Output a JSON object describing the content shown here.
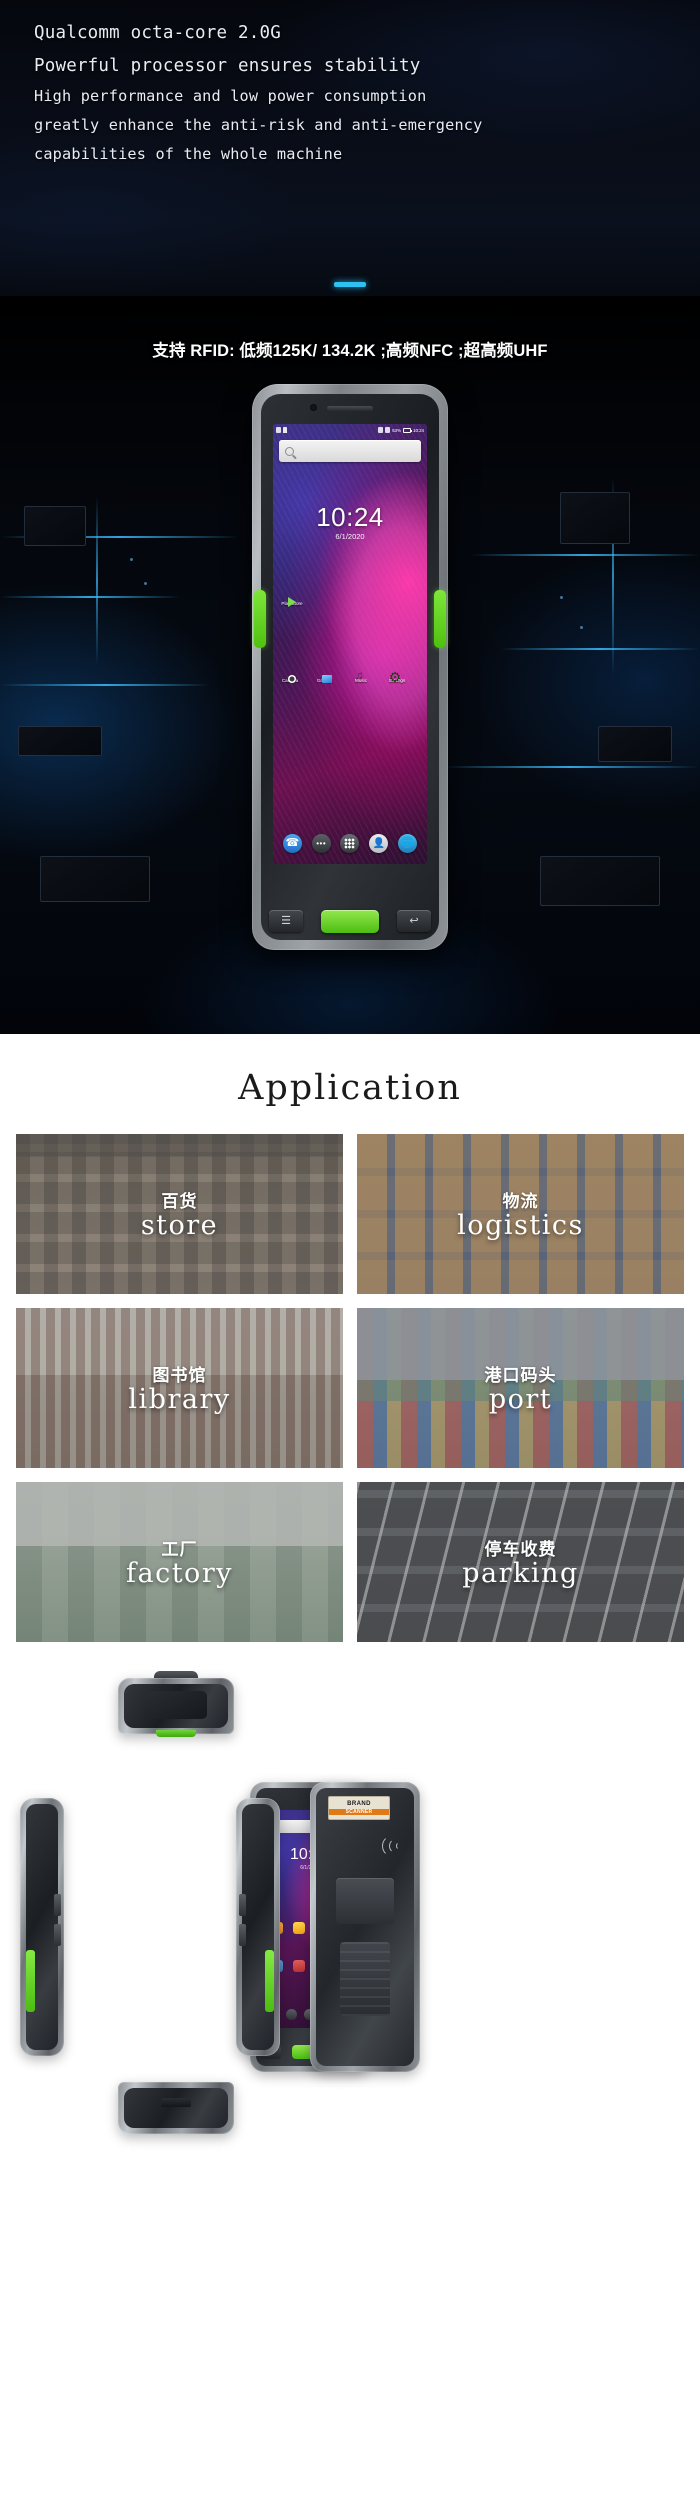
{
  "hero": {
    "lines": [
      "Qualcomm octa-core 2.0G",
      "Powerful processor ensures stability",
      "High performance and low power consumption",
      "greatly enhance the anti-risk and anti-emergency",
      "capabilities of the whole machine"
    ],
    "accent_color": "#2ec2f3",
    "background_color": "#080c16"
  },
  "product": {
    "rfid_title": "支持 RFID: 低频125K/ 134.2K ;高频NFC ;超高频UHF",
    "device": {
      "status_bar": {
        "battery": "53%",
        "time": "10:24"
      },
      "search_placeholder": "",
      "clock": "10:24",
      "date": "6/1/2020",
      "apps": [
        {
          "name": "play-store-icon",
          "label": "Play Store"
        },
        {
          "name": "camera-icon",
          "label": "Camera"
        },
        {
          "name": "gallery-icon",
          "label": "Gallery"
        },
        {
          "name": "music-icon",
          "label": "Music"
        },
        {
          "name": "settings-icon",
          "label": "Settings"
        }
      ],
      "dock": [
        "phone-icon",
        "messages-icon",
        "app-drawer-icon",
        "contacts-icon",
        "browser-icon"
      ],
      "nav": [
        "menu-button",
        "scan-button",
        "back-button"
      ]
    }
  },
  "application": {
    "title": "Application",
    "tiles": [
      {
        "cn": "百货",
        "en": "store",
        "photo": "ph-store",
        "name": "tile-store"
      },
      {
        "cn": "物流",
        "en": "logistics",
        "photo": "ph-logistics",
        "name": "tile-logistics"
      },
      {
        "cn": "图书馆",
        "en": "library",
        "photo": "ph-library",
        "name": "tile-library"
      },
      {
        "cn": "港口码头",
        "en": "port",
        "photo": "ph-port",
        "name": "tile-port"
      },
      {
        "cn": "工厂",
        "en": "factory",
        "photo": "ph-factory",
        "name": "tile-factory"
      },
      {
        "cn": "停车收费",
        "en": "parking",
        "photo": "ph-parking",
        "name": "tile-parking"
      }
    ]
  },
  "views": {
    "front_clock": "10:24",
    "front_date": "6/1/2020",
    "brand_tag": {
      "name": "BRAND",
      "sub": "SCANNER"
    }
  }
}
